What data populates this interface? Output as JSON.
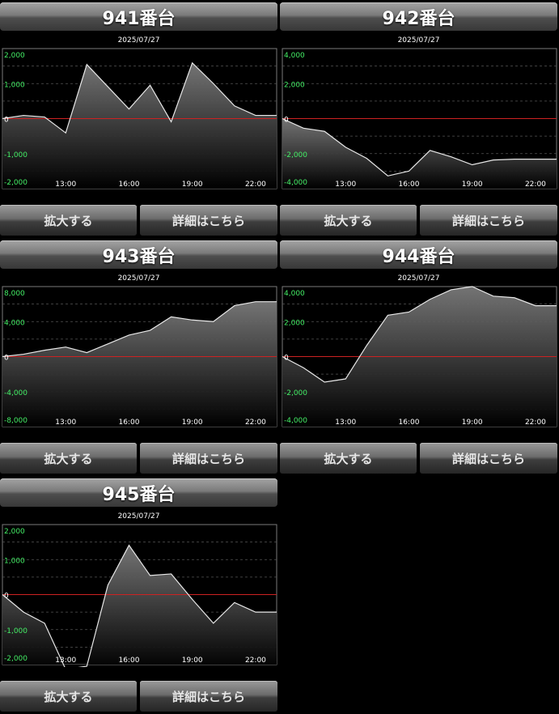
{
  "chart_data": [
    {
      "type": "area",
      "title": "941番台",
      "date": "2025/07/27",
      "y_ticks": [
        "2,000",
        "1,000",
        "0",
        "-1,000",
        "-2,000"
      ],
      "ylim": [
        -2200,
        2200
      ],
      "x_ticks": [
        "13:00",
        "16:00",
        "19:00",
        "22:00"
      ],
      "x": [
        10,
        11,
        12,
        13,
        14,
        15,
        16,
        17,
        18,
        19,
        20,
        21,
        22,
        23
      ],
      "values": [
        0,
        100,
        50,
        -450,
        1700,
        1000,
        300,
        1050,
        -100,
        1750,
        1100,
        400,
        100,
        100
      ],
      "zoom_label": "拡大する",
      "detail_label": "詳細はこちら"
    },
    {
      "type": "area",
      "title": "942番台",
      "date": "2025/07/27",
      "y_ticks": [
        "4,000",
        "2,000",
        "0",
        "-2,000",
        "-4,000"
      ],
      "ylim": [
        -4400,
        4400
      ],
      "x_ticks": [
        "13:00",
        "16:00",
        "19:00",
        "22:00"
      ],
      "x": [
        10,
        11,
        12,
        13,
        14,
        15,
        16,
        17,
        18,
        19,
        20,
        21,
        22,
        23
      ],
      "values": [
        0,
        -600,
        -800,
        -1800,
        -2500,
        -3600,
        -3300,
        -2000,
        -2400,
        -2900,
        -2600,
        -2550,
        -2550,
        -2550
      ],
      "zoom_label": "拡大する",
      "detail_label": "詳細はこちら"
    },
    {
      "type": "area",
      "title": "943番台",
      "date": "2025/07/27",
      "y_ticks": [
        "8,000",
        "4,000",
        "0",
        "-4,000",
        "-8,000"
      ],
      "ylim": [
        -8800,
        8800
      ],
      "x_ticks": [
        "13:00",
        "16:00",
        "19:00",
        "22:00"
      ],
      "x": [
        10,
        11,
        12,
        13,
        14,
        15,
        16,
        17,
        18,
        19,
        20,
        21,
        22,
        23
      ],
      "values": [
        0,
        300,
        800,
        1200,
        500,
        1600,
        2700,
        3300,
        5000,
        4600,
        4400,
        6400,
        6900,
        6900
      ],
      "zoom_label": "拡大する",
      "detail_label": "詳細はこちら"
    },
    {
      "type": "area",
      "title": "944番台",
      "date": "2025/07/27",
      "y_ticks": [
        "4,000",
        "2,000",
        "0",
        "-2,000",
        "-4,000"
      ],
      "ylim": [
        -4400,
        4400
      ],
      "x_ticks": [
        "13:00",
        "16:00",
        "19:00",
        "22:00"
      ],
      "x": [
        10,
        11,
        12,
        13,
        14,
        15,
        16,
        17,
        18,
        19,
        20,
        21,
        22,
        23
      ],
      "values": [
        0,
        -700,
        -1600,
        -1400,
        700,
        2600,
        2800,
        3600,
        4200,
        4400,
        3800,
        3700,
        3200,
        3200
      ],
      "zoom_label": "拡大する",
      "detail_label": "詳細はこちら"
    },
    {
      "type": "area",
      "title": "945番台",
      "date": "2025/07/27",
      "y_ticks": [
        "2,000",
        "1,000",
        "0",
        "-1,000",
        "-2,000"
      ],
      "ylim": [
        -2200,
        2200
      ],
      "x_ticks": [
        "13:00",
        "16:00",
        "19:00",
        "22:00"
      ],
      "x": [
        10,
        11,
        12,
        13,
        14,
        15,
        16,
        17,
        18,
        19,
        20,
        21,
        22,
        23
      ],
      "values": [
        0,
        -550,
        -900,
        -2350,
        -2250,
        300,
        1550,
        600,
        650,
        -150,
        -900,
        -250,
        -550,
        -550
      ],
      "zoom_label": "拡大する",
      "detail_label": "詳細はこちら"
    }
  ],
  "colors": {
    "tick_green": "#44ee66",
    "zero_line": "#cc2222",
    "series_line": "#e8e8e8",
    "grid": "#555555"
  },
  "x_axis_range": [
    10,
    23
  ]
}
